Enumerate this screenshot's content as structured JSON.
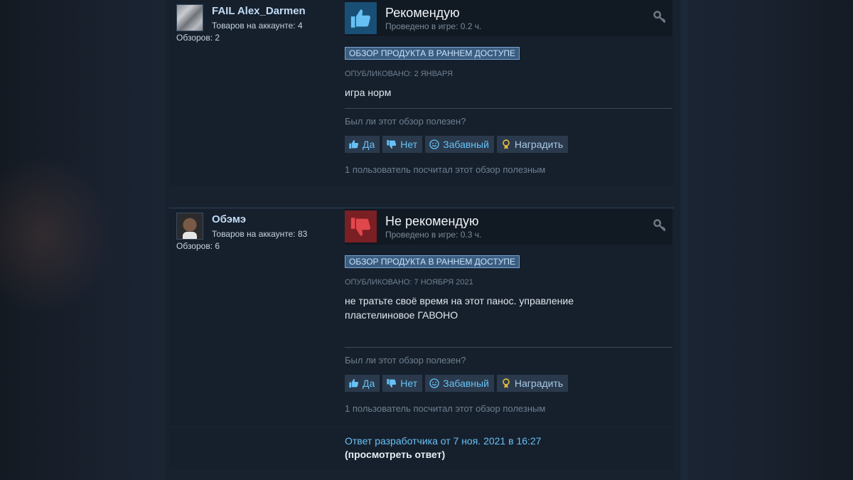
{
  "colors": {
    "page_bg": "#1b2838",
    "review_bg": "#16202d",
    "link_blue": "#67c1f5",
    "recommended_thumb_bg": "#1a4f75",
    "not_recommended_thumb_bg": "#7a1f23"
  },
  "reviews": [
    {
      "author": {
        "name": "FAIL Alex_Darmen",
        "products": "Товаров на аккаунте: 4",
        "reviews": "Обзоров: 2"
      },
      "verdict": "Рекомендую",
      "verdict_icon": "thumbs-up-icon",
      "hours": "Проведено в игре: 0.2 ч.",
      "badge": "Обзор продукта в раннем доступе",
      "posted": "Опубликовано: 2 января",
      "content": "игра норм",
      "helpful_question": "Был ли этот обзор полезен?",
      "buttons": {
        "yes": "Да",
        "no": "Нет",
        "funny": "Забавный",
        "award": "Наградить"
      },
      "helpful_count": "1 пользователь посчитал этот обзор полезным"
    },
    {
      "author": {
        "name": "Обэмэ",
        "products": "Товаров на аккаунте: 83",
        "reviews": "Обзоров: 6"
      },
      "verdict": "Не рекомендую",
      "verdict_icon": "thumbs-down-icon",
      "hours": "Проведено в игре: 0.3 ч.",
      "badge": "Обзор продукта в раннем доступе",
      "posted": "Опубликовано: 7 ноября 2021",
      "content": "не тратьте своё время на этот панос. управление пластелиновое ГАВОНО",
      "helpful_question": "Был ли этот обзор полезен?",
      "buttons": {
        "yes": "Да",
        "no": "Нет",
        "funny": "Забавный",
        "award": "Наградить"
      },
      "helpful_count": "1 пользователь посчитал этот обзор полезным"
    }
  ],
  "developer_response": {
    "link": "Ответ разработчика от 7 ноя. 2021 в 16:27",
    "view": "(просмотреть ответ)"
  }
}
